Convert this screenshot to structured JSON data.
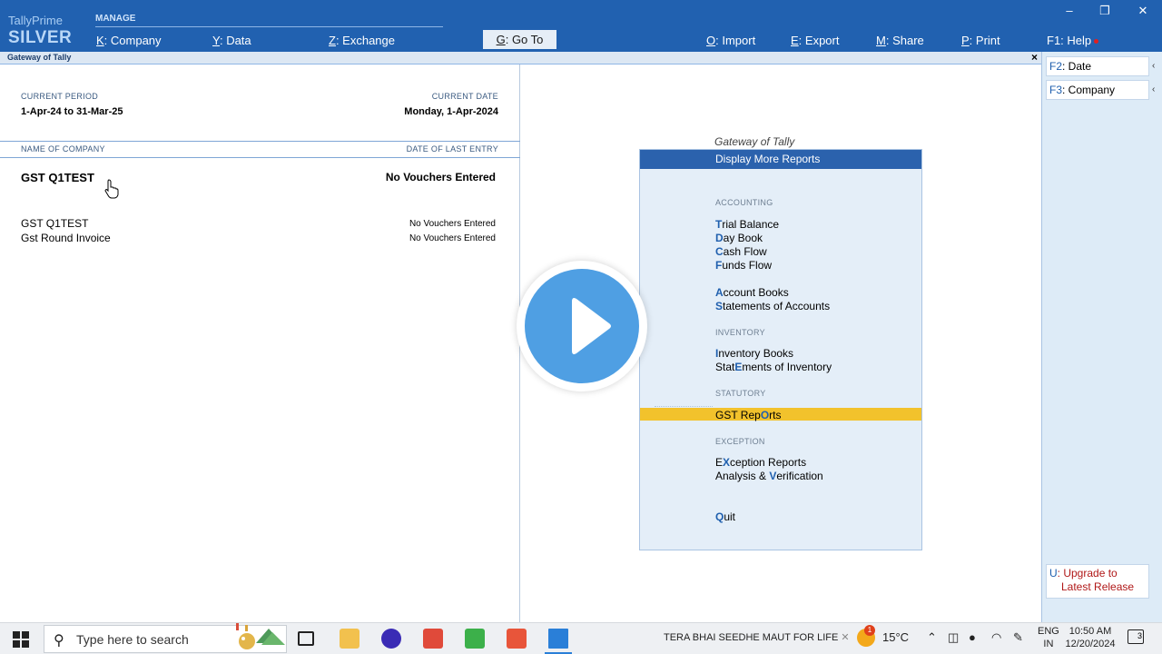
{
  "brand": {
    "line1": "TallyPrime",
    "line2": "SILVER"
  },
  "topmenu": {
    "manage_label": "MANAGE",
    "items": [
      {
        "key": "K",
        "label": ": Company"
      },
      {
        "key": "Y",
        "label": ": Data"
      },
      {
        "key": "Z",
        "label": ": Exchange"
      },
      {
        "key": "O",
        "label": ": Import"
      },
      {
        "key": "E",
        "label": ": Export"
      },
      {
        "key": "M",
        "label": ": Share"
      },
      {
        "key": "P",
        "label": ": Print"
      },
      {
        "key": "F1",
        "label": ": Help"
      }
    ],
    "goto": {
      "key": "G",
      "label": ": Go To"
    }
  },
  "window_controls": {
    "minimize": "–",
    "restore": "❐",
    "close": "✕"
  },
  "titlebar": {
    "title": "Gateway of Tally",
    "close": "×"
  },
  "left": {
    "current_period_label": "CURRENT PERIOD",
    "current_period": "1-Apr-24 to 31-Mar-25",
    "current_date_label": "CURRENT DATE",
    "current_date": "Monday, 1-Apr-2024",
    "name_of_company_label": "NAME OF COMPANY",
    "date_of_last_entry_label": "DATE OF LAST ENTRY",
    "active_company": "GST Q1TEST",
    "active_status": "No Vouchers Entered",
    "companies": [
      {
        "name": "GST Q1TEST",
        "status": "No Vouchers Entered"
      },
      {
        "name": "Gst Round Invoice",
        "status": "No Vouchers Entered"
      }
    ]
  },
  "gateway": {
    "title": "Gateway of Tally",
    "header": "Display More Reports",
    "sections": {
      "accounting": "ACCOUNTING",
      "inventory": "INVENTORY",
      "statutory": "STATUTORY",
      "exception": "EXCEPTION"
    },
    "items": {
      "trial_balance": {
        "pre": "",
        "hot": "T",
        "post": "rial Balance"
      },
      "day_book": {
        "pre": "",
        "hot": "D",
        "post": "ay Book"
      },
      "cash_flow": {
        "pre": "",
        "hot": "C",
        "post": "ash Flow"
      },
      "funds_flow": {
        "pre": "",
        "hot": "F",
        "post": "unds Flow"
      },
      "account_books": {
        "pre": "",
        "hot": "A",
        "post": "ccount Books"
      },
      "statements_of_accounts": {
        "pre": "",
        "hot": "S",
        "post": "tatements of Accounts"
      },
      "inventory_books": {
        "pre": "",
        "hot": "I",
        "post": "nventory Books"
      },
      "statements_of_inventory": {
        "pre": "Stat",
        "hot": "E",
        "post": "ments of Inventory"
      },
      "gst_reports": {
        "pre": "GST Rep",
        "hot": "O",
        "post": "rts"
      },
      "exception_reports": {
        "pre": "E",
        "hot": "X",
        "post": "ception Reports"
      },
      "analysis_verification": {
        "pre": "Analysis & ",
        "hot": "V",
        "post": "erification"
      },
      "quit": {
        "pre": "",
        "hot": "Q",
        "post": "uit"
      }
    }
  },
  "sidebar": {
    "date": {
      "key": "F2",
      "label": ": Date"
    },
    "company": {
      "key": "F3",
      "label": ": Company"
    },
    "upgrade": {
      "key": "U",
      "label1": ": Upgrade to",
      "label2": "Latest Release"
    }
  },
  "taskbar": {
    "search_placeholder": "Type here to search",
    "news": "TERA BHAI SEEDHE MAUT FOR LIFE",
    "temperature": "15°C",
    "lang1": "ENG",
    "lang2": "IN",
    "time": "10:50 AM",
    "date": "12/20/2024",
    "notifications": "3",
    "weather_badge": "1"
  },
  "colors": {
    "topbar": "#2161b0",
    "menu_header": "#2b62ad",
    "highlight": "#f2c22c",
    "menu_bg": "#e4eef8",
    "play": "#4f9fe3"
  }
}
